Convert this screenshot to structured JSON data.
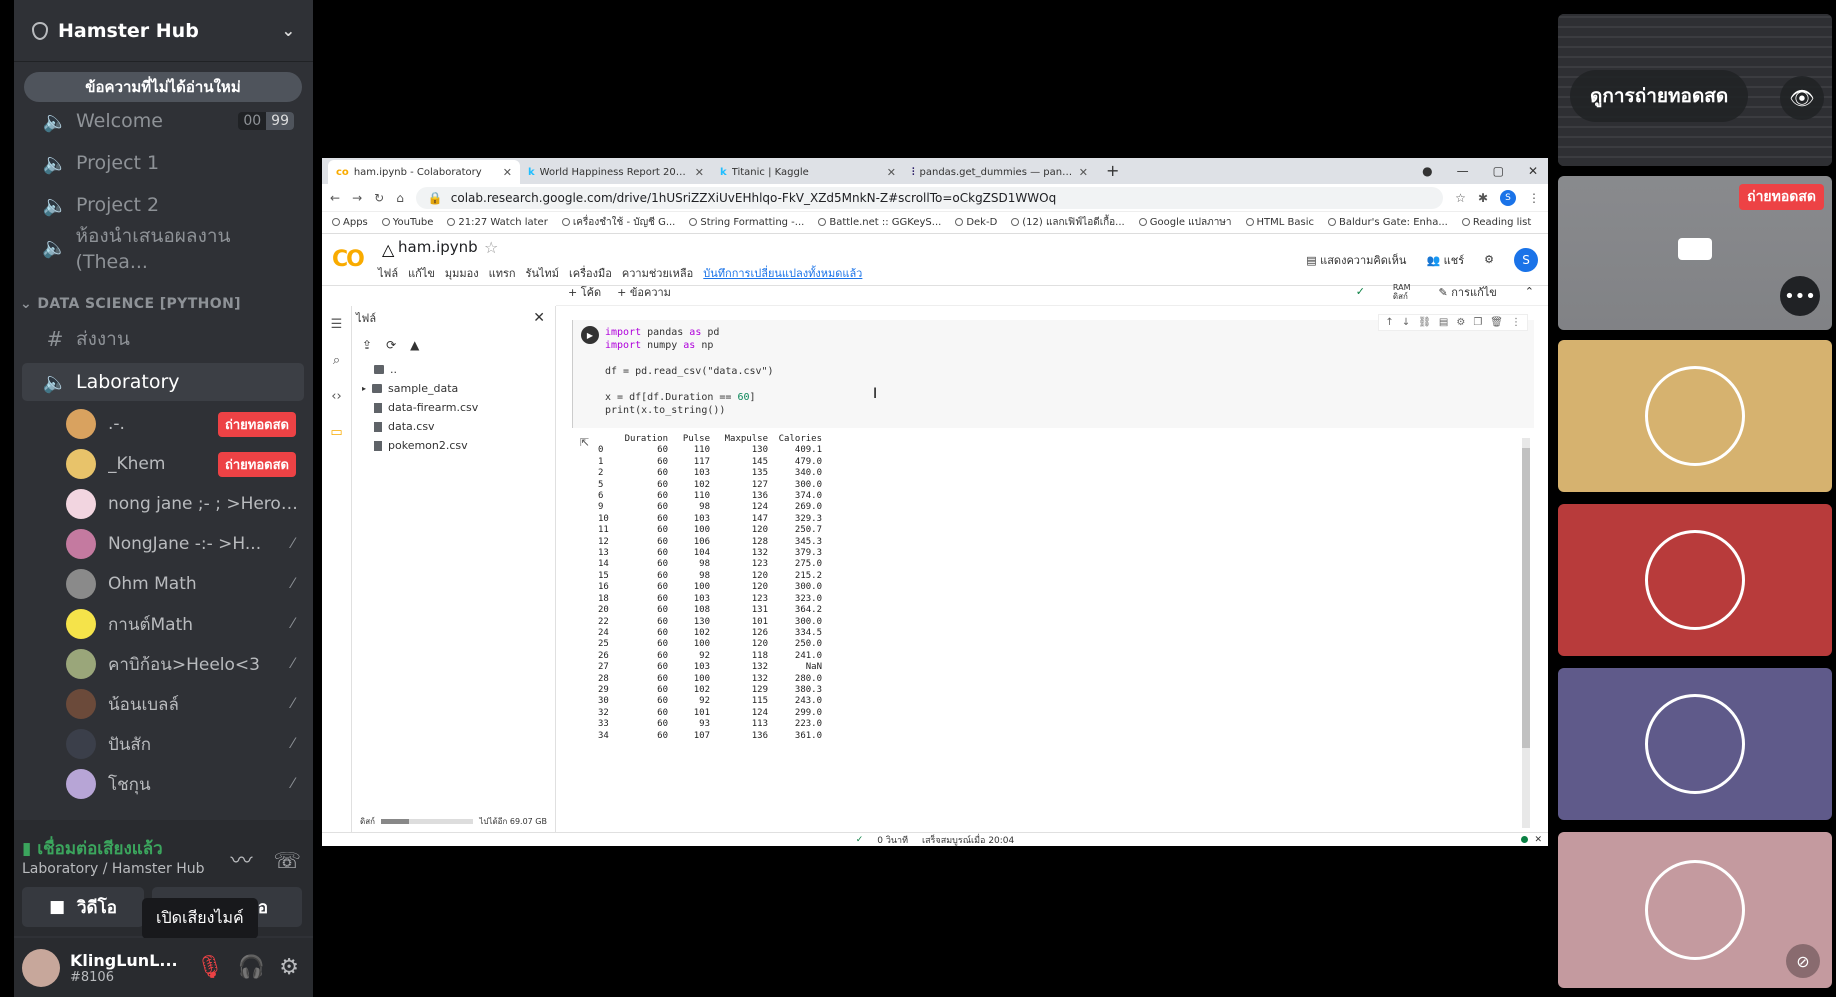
{
  "server": {
    "name": "Hamster Hub"
  },
  "unread_banner": "ข้อความที่ไม่ได้อ่านใหม่",
  "channels": [
    {
      "label": "Welcome",
      "counts": [
        "00",
        "99"
      ]
    },
    {
      "label": "Project 1"
    },
    {
      "label": "Project 2"
    },
    {
      "label": "ห้องนำเสนอผลงาน (Thea..."
    }
  ],
  "category": "DATA SCIENCE [PYTHON]",
  "text_channel": "ส่งงาน",
  "voice_channel": "Laboratory",
  "voice_users": [
    {
      "name": ".-.",
      "badge": "ถ่ายทอดสด",
      "color": "#d9a25f"
    },
    {
      "name": "_Khem",
      "badge": "ถ่ายทอดสด",
      "color": "#e8c36a"
    },
    {
      "name": "nong jane ;- ; >Hero<3",
      "color": "#f2d5e0"
    },
    {
      "name": "NongJane -:- >H...",
      "color": "#c47aa0"
    },
    {
      "name": "Ohm Math",
      "color": "#8a8a8a"
    },
    {
      "name": "กานต์Math",
      "color": "#f5e34a"
    },
    {
      "name": "คาบิก้อน>Heelo<3",
      "color": "#9aa67a"
    },
    {
      "name": "น้อนเบลล์",
      "color": "#6b4a3a"
    },
    {
      "name": "ปันสัก",
      "color": "#3b3f4a"
    },
    {
      "name": "โชกุน",
      "color": "#b7a5d6"
    }
  ],
  "voice_status": {
    "connected": "เชื่อมต่อเสียงแล้ว",
    "location": "Laboratory / Hamster Hub",
    "video_label": "วิดีโอ",
    "screen_label_tail": "อ"
  },
  "tooltip": "เปิดเสียงไมค์",
  "user": {
    "name": "KlingLunL...",
    "tag": "#8106"
  },
  "browser": {
    "tabs": [
      "ham.ipynb - Colaboratory",
      "World Happiness Report 2021 | K",
      "Titanic | Kaggle",
      "pandas.get_dummies — pandas"
    ],
    "url": "colab.research.google.com/drive/1hUSriZZXiUvEHhlqo-FkV_XZd5MnkN-Z#scrollTo=oCkgZSD1WWOq",
    "bookmarks": [
      "Apps",
      "YouTube",
      "21:27 Watch later",
      "เครื่องชำใช้ - บัญชี G...",
      "String Formatting -...",
      "Battle.net :: GGKeyS...",
      "Dek-D",
      "(12) แลกเฟิฟ์ไอดีเกื้อ...",
      "Google แปลภาษา",
      "HTML Basic",
      "Baldur's Gate: Enha...",
      "Reading list"
    ]
  },
  "colab": {
    "logo": "CO",
    "notebook": "ham.ipynb",
    "menu": [
      "ไฟล์",
      "แก้ไข",
      "มุมมอง",
      "แทรก",
      "รันไทม์",
      "เครื่องมือ",
      "ความช่วยเหลือ"
    ],
    "saved": "บันทึกการเปลี่ยนแปลงทั้งหมดแล้ว",
    "comment": "แสดงความคิดเห็น",
    "share": "แชร์",
    "user_initial": "S",
    "add_code": "+ โค้ด",
    "add_text": "+ ข้อความ",
    "ram": "RAM",
    "disk": "ดิสก์",
    "edit": "การแก้ไข",
    "files_title": "ไฟล์",
    "files": [
      "..",
      "sample_data",
      "data-firearm.csv",
      "data.csv",
      "pokemon2.csv"
    ],
    "disk_label": "ดิสก์",
    "disk_free": "ไปได้อีก 69.07 GB",
    "disk_used_fraction": 0.3,
    "status_time": "0 วินาที",
    "status_done": "เสร็จสมบูรณ์เมื่อ 20:04"
  },
  "code": {
    "l1a": "import",
    "l1b": " pandas ",
    "l1c": "as",
    "l1d": " pd",
    "l2a": "import",
    "l2b": " numpy ",
    "l2c": "as",
    "l2d": " np",
    "l3": "df = pd.read_csv(\"data.csv\")",
    "l4a": "x = df[df.Duration == ",
    "l4b": "60",
    "l4c": "]",
    "l5": "print(x.to_string())"
  },
  "output": {
    "columns": [
      "Duration",
      "Pulse",
      "Maxpulse",
      "Calories"
    ],
    "rows": [
      [
        "0",
        "60",
        "110",
        "130",
        "409.1"
      ],
      [
        "1",
        "60",
        "117",
        "145",
        "479.0"
      ],
      [
        "2",
        "60",
        "103",
        "135",
        "340.0"
      ],
      [
        "5",
        "60",
        "102",
        "127",
        "300.0"
      ],
      [
        "6",
        "60",
        "110",
        "136",
        "374.0"
      ],
      [
        "9",
        "60",
        "98",
        "124",
        "269.0"
      ],
      [
        "10",
        "60",
        "103",
        "147",
        "329.3"
      ],
      [
        "11",
        "60",
        "100",
        "120",
        "250.7"
      ],
      [
        "12",
        "60",
        "106",
        "128",
        "345.3"
      ],
      [
        "13",
        "60",
        "104",
        "132",
        "379.3"
      ],
      [
        "14",
        "60",
        "98",
        "123",
        "275.0"
      ],
      [
        "15",
        "60",
        "98",
        "120",
        "215.2"
      ],
      [
        "16",
        "60",
        "100",
        "120",
        "300.0"
      ],
      [
        "18",
        "60",
        "103",
        "123",
        "323.0"
      ],
      [
        "20",
        "60",
        "108",
        "131",
        "364.2"
      ],
      [
        "22",
        "60",
        "130",
        "101",
        "300.0"
      ],
      [
        "24",
        "60",
        "102",
        "126",
        "334.5"
      ],
      [
        "25",
        "60",
        "100",
        "120",
        "250.0"
      ],
      [
        "26",
        "60",
        "92",
        "118",
        "241.0"
      ],
      [
        "27",
        "60",
        "103",
        "132",
        "NaN"
      ],
      [
        "28",
        "60",
        "100",
        "132",
        "280.0"
      ],
      [
        "29",
        "60",
        "102",
        "129",
        "380.3"
      ],
      [
        "30",
        "60",
        "92",
        "115",
        "243.0"
      ],
      [
        "32",
        "60",
        "101",
        "124",
        "299.0"
      ],
      [
        "33",
        "60",
        "93",
        "113",
        "223.0"
      ],
      [
        "34",
        "60",
        "107",
        "136",
        "361.0"
      ]
    ]
  },
  "tiles": {
    "watch_stream": "ดูการถ่ายทอดสด",
    "live": "ถ่ายทอดสด",
    "avatar_colors": [
      "#d6b26f",
      "#b83b3b",
      "#5f5a8a",
      "#c49a9f"
    ]
  }
}
